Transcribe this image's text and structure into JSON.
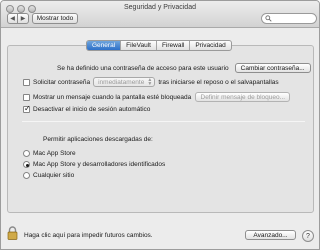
{
  "window": {
    "title": "Seguridad y Privacidad",
    "show_all_label": "Mostrar todo"
  },
  "tabs": [
    {
      "label": "General",
      "active": true
    },
    {
      "label": "FileVault",
      "active": false
    },
    {
      "label": "Firewall",
      "active": false
    },
    {
      "label": "Privacidad",
      "active": false
    }
  ],
  "general": {
    "password_text": "Se ha definido una contraseña de acceso para este usuario",
    "change_password_label": "Cambiar contraseña...",
    "require_password_label": "Solicitar contraseña",
    "require_password_checked": false,
    "require_password_delay": "inmediatamente",
    "require_password_suffix": "tras iniciarse el reposo o el salvapantallas",
    "show_message_label": "Mostrar un mensaje cuando la pantalla esté bloqueada",
    "show_message_checked": false,
    "set_lock_message_label": "Definir mensaje de bloqueo...",
    "disable_autologin_label": "Desactivar el inicio de sesión automático",
    "disable_autologin_checked": true,
    "allow_apps_heading": "Permitir aplicaciones descargadas de:",
    "allow_options": [
      {
        "label": "Mac App Store",
        "selected": false
      },
      {
        "label": "Mac App Store y desarrolladores identificados",
        "selected": true
      },
      {
        "label": "Cualquier sitio",
        "selected": false
      }
    ]
  },
  "footer": {
    "lock_text": "Haga clic aquí para impedir futuros cambios.",
    "advanced_label": "Avanzado...",
    "help_label": "?"
  },
  "icons": {
    "back": "chevron-left-icon",
    "forward": "chevron-right-icon",
    "search": "search-icon",
    "lock": "lock-icon"
  }
}
